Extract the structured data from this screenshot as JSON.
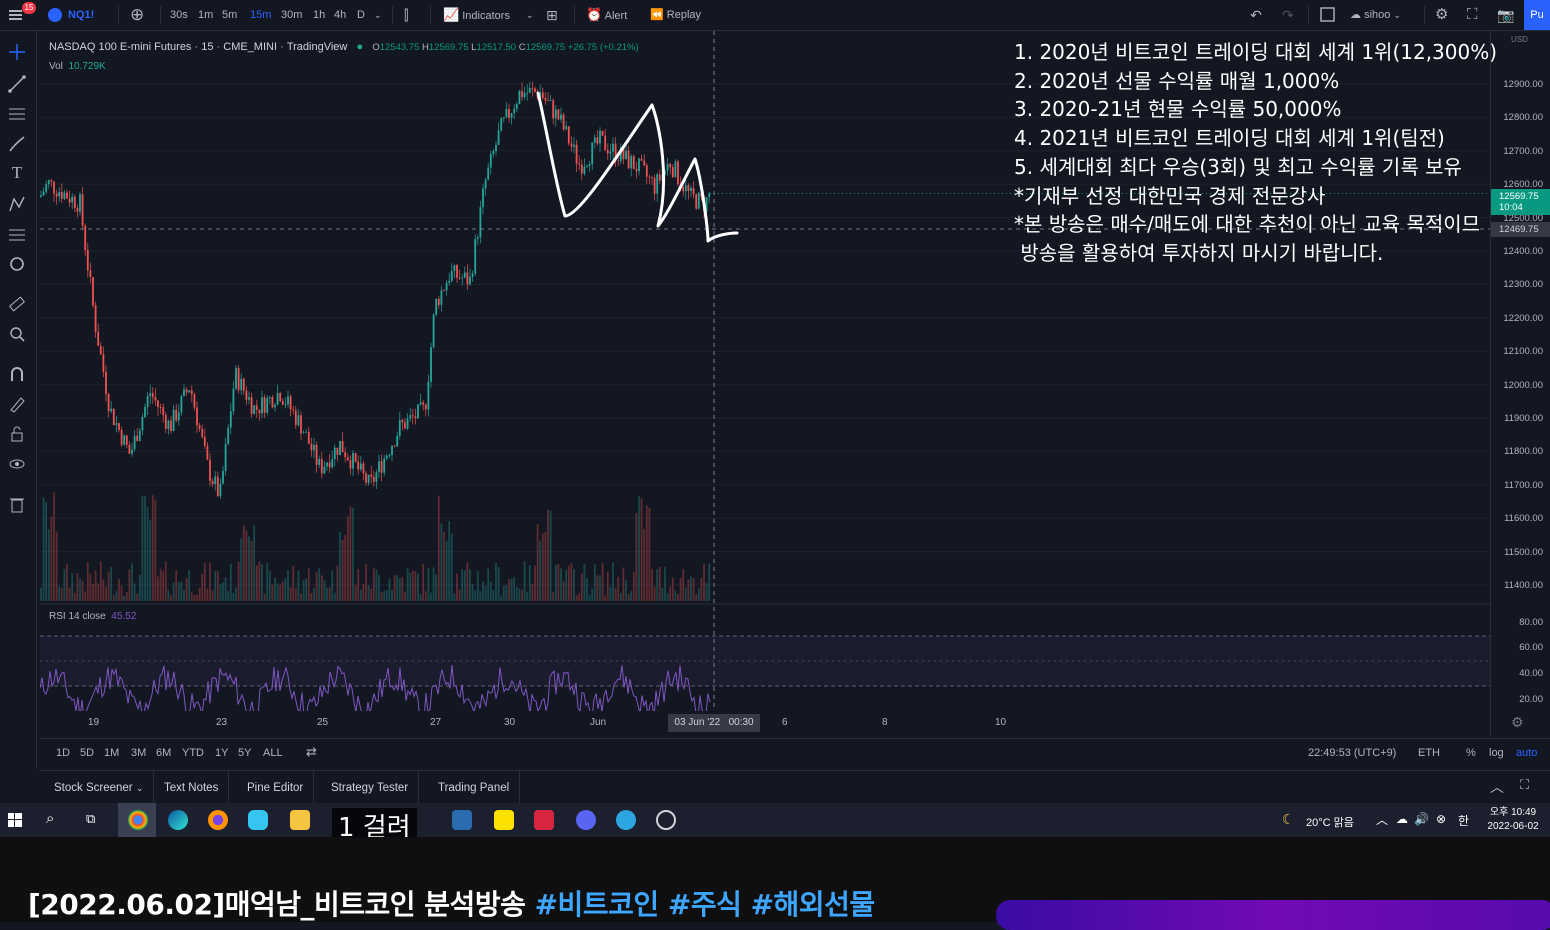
{
  "topbar": {
    "badge": "15",
    "symbol": "NQ1!",
    "intervals": [
      "30s",
      "1m",
      "5m",
      "15m",
      "30m",
      "1h",
      "4h",
      "D"
    ],
    "active_interval": "15m",
    "indicators_label": "Indicators",
    "alert_label": "Alert",
    "replay_label": "Replay",
    "layout_name": "sihoo",
    "publish_label": "Pu"
  },
  "legend": {
    "title": "NASDAQ 100 E-mini Futures",
    "interval": "15",
    "exchange": "CME_MINI",
    "source": "TradingView",
    "ohlc": {
      "o_label": "O",
      "o": "12543.75",
      "h_label": "H",
      "h": "12569.75",
      "l_label": "L",
      "l": "12517.50",
      "c_label": "C",
      "c": "12569.75",
      "change": "+26.75 (+0.21%)"
    },
    "vol_label": "Vol",
    "vol_value": "10.729K"
  },
  "overlay": {
    "lines": [
      "1. 2020년 비트코인 트레이딩 대회 세계 1위(12,300%)",
      "2. 2020년 선물 수익률 매월 1,000%",
      "3. 2020-21년 현물 수익률 50,000%",
      "4. 2021년 비트코인 트레이딩 대회 세계 1위(팀전)",
      "5. 세계대회 최다 우승(3회) 및 최고 수익률 기록 보유",
      "*기재부 선정 대한민국 경제 전문강사",
      "*본 방송은 매수/매도에 대한 추천이 아닌 교육 목적이므",
      " 방송을 활용하여 투자하지 마시기 바랍니다."
    ]
  },
  "price_axis": {
    "currency": "USD",
    "labels": [
      "12900.00",
      "12800.00",
      "12700.00",
      "12600.00",
      "12500.00",
      "12400.00",
      "12300.00",
      "12200.00",
      "12100.00",
      "12000.00",
      "11900.00",
      "11800.00",
      "11700.00",
      "11600.00",
      "11500.00",
      "11400.00"
    ],
    "current_price": "12569.75",
    "countdown": "10:04",
    "crosshair_price": "12469.75",
    "rsi_labels": [
      "80.00",
      "60.00",
      "40.00",
      "20.00"
    ]
  },
  "rsi": {
    "label": "RSI",
    "params": "14 close",
    "value": "45.52"
  },
  "time_axis": {
    "labels": [
      "19",
      "23",
      "25",
      "27",
      "30",
      "Jun",
      "6",
      "8",
      "10"
    ],
    "crosshair_date": "03 Jun '22",
    "crosshair_time": "00:30"
  },
  "range_bar": {
    "ranges": [
      "1D",
      "5D",
      "1M",
      "3M",
      "6M",
      "YTD",
      "1Y",
      "5Y",
      "ALL"
    ],
    "clock": "22:49:53 (UTC+9)",
    "session": "ETH",
    "percent_label": "%",
    "log_label": "log",
    "auto_label": "auto"
  },
  "bottom_panels": [
    "Stock Screener",
    "Text Notes",
    "Pine Editor",
    "Strategy Tester",
    "Trading Panel"
  ],
  "taskbar": {
    "weather": "20°C 맑음",
    "ampm_time": "오후 10:49",
    "date": "2022-06-02",
    "subtitle": "1 걸려"
  },
  "video": {
    "title_main": "[2022.06.02]매억남_비트코인 분석방송 ",
    "tags": [
      "#비트코인",
      "#주식",
      "#해외선물"
    ]
  },
  "chart_data": {
    "type": "candlestick",
    "instrument": "NASDAQ 100 E-mini Futures",
    "ylim": [
      11400,
      12950
    ],
    "x_range": [
      "May 17",
      "Jun 11"
    ],
    "last_close": 12569.75,
    "close_path": [
      [
        "May 17",
        12600
      ],
      [
        "May 18",
        12480
      ],
      [
        "May 18",
        12000
      ],
      [
        "May 19",
        11880
      ],
      [
        "May 20",
        11850
      ],
      [
        "May 20",
        11780
      ],
      [
        "May 23",
        11980
      ],
      [
        "May 24",
        11900
      ],
      [
        "May 25",
        11880
      ],
      [
        "May 25",
        11750
      ],
      [
        "May 26",
        11900
      ],
      [
        "May 27",
        12150
      ],
      [
        "May 27",
        12400
      ],
      [
        "May 29",
        12700
      ],
      [
        "May 30",
        12880
      ],
      [
        "May 31",
        12700
      ],
      [
        "Jun 1",
        12650
      ],
      [
        "Jun 2",
        12560
      ],
      [
        "Jun 3",
        12569.75
      ]
    ],
    "rsi": {
      "ylim": [
        20,
        90
      ],
      "levels": [
        70,
        30
      ],
      "last": 45.52
    }
  }
}
